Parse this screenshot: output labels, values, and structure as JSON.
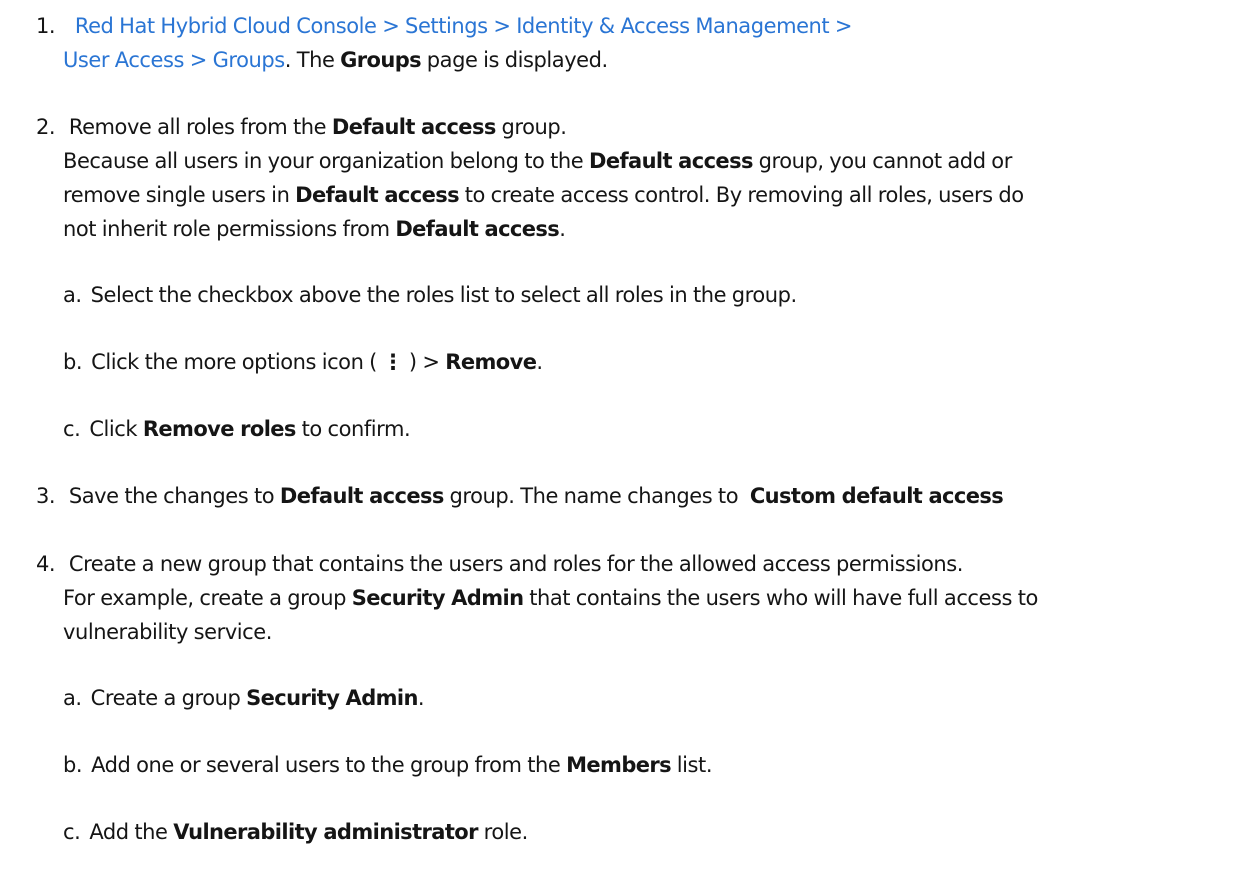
{
  "steps": [
    {
      "number": "1.",
      "breadcrumb_line1": "Red Hat Hybrid Cloud Console > Settings > Identity & Access Management >",
      "breadcrumb_line2": "User Access > Groups",
      "after_link": ". The ",
      "groups_bold": "Groups",
      "after_groups": " page is displayed."
    },
    {
      "number": "2.",
      "text1": "Remove all roles from the ",
      "bold1": "Default access",
      "text2": " group.",
      "line2_a": "Because all users in your organization belong to the ",
      "line2_bold": "Default access",
      "line2_b": " group, you cannot add or",
      "line3_a": "remove single users in ",
      "line3_bold": "Default access",
      "line3_b": " to create access control. By removing all roles, users do",
      "line4_a": "not inherit role permissions from ",
      "line4_bold": "Default access",
      "line4_b": ".",
      "substeps": [
        {
          "label": "a.",
          "text": "Select the checkbox above the roles list to select all roles in the group."
        },
        {
          "label": "b.",
          "text_a": "Click the more options icon ( ",
          "icon": "⋮",
          "text_b": " ) > ",
          "bold": "Remove",
          "text_c": "."
        },
        {
          "label": "c.",
          "text_a": "Click ",
          "bold": "Remove roles",
          "text_b": " to confirm."
        }
      ]
    },
    {
      "number": "3.",
      "text_a": "Save the changes to ",
      "bold1": "Default access",
      "text_b": " group. The name changes to ",
      "bold2": "Custom default access"
    },
    {
      "number": "4.",
      "text1": "Create a new group that contains the users and roles for the allowed access permissions.",
      "line2_a": "For example, create a group ",
      "line2_bold": "Security Admin",
      "line2_b": " that contains the users who will have full access to",
      "line3": "vulnerability service.",
      "substeps": [
        {
          "label": "a.",
          "text_a": "Create a group ",
          "bold": "Security Admin",
          "text_b": "."
        },
        {
          "label": "b.",
          "text_a": "Add one or several users to the group from the ",
          "bold": "Members",
          "text_b": " list."
        },
        {
          "label": "c.",
          "text_a": "Add the ",
          "bold": "Vulnerability administrator",
          "text_b": " role."
        }
      ]
    }
  ],
  "colors": {
    "text": "#151515",
    "link": "#2a75d4",
    "background": "#ffffff"
  }
}
